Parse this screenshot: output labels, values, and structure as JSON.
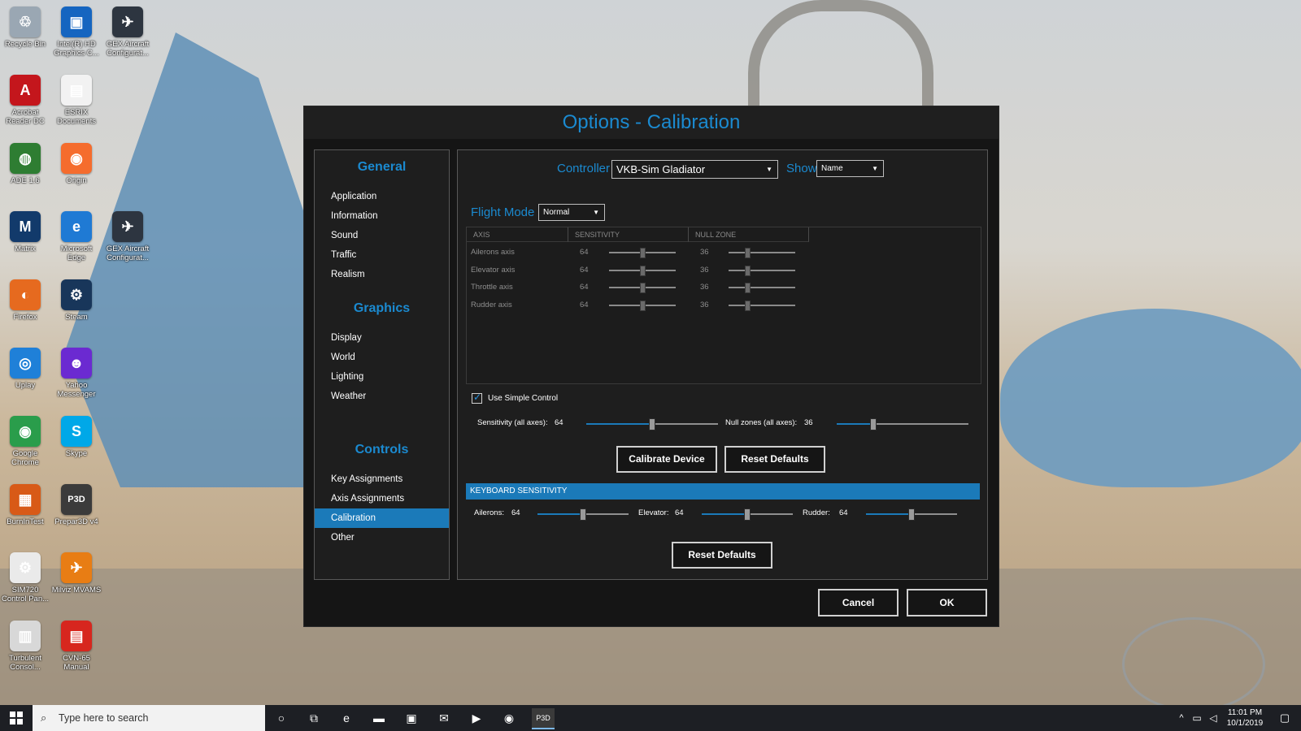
{
  "desktop": {
    "icons": [
      {
        "label": "Recycle Bin",
        "icon": "recycle-bin-icon",
        "color": "#9aa7b3",
        "glyph": "♲"
      },
      {
        "label": "Intel(R) HD Graphics C...",
        "icon": "intel-graphics-icon",
        "color": "#1565c0",
        "glyph": "▣"
      },
      {
        "label": "GEX Aircraft Configurat...",
        "icon": "gex-aircraft-icon",
        "color": "#2d3540",
        "glyph": "✈"
      },
      {
        "label": "Acrobat Reader DC",
        "icon": "acrobat-icon",
        "color": "#c4161c",
        "glyph": "A"
      },
      {
        "label": "ESRIX Documents",
        "icon": "document-icon",
        "color": "#f2f2f2",
        "glyph": "▤"
      },
      {
        "label": "ADE 1.6",
        "icon": "ade-globe-icon",
        "color": "#2e7d32",
        "glyph": "◍"
      },
      {
        "label": "Origin",
        "icon": "origin-icon",
        "color": "#f56c2d",
        "glyph": "◉"
      },
      {
        "label": "Matrix",
        "icon": "matrix-icon",
        "color": "#123a6b",
        "glyph": "M"
      },
      {
        "label": "Microsoft Edge",
        "icon": "edge-icon",
        "color": "#1f7ad4",
        "glyph": "e"
      },
      {
        "label": "GEX Aircraft Configurat...",
        "icon": "gex-aircraft-icon",
        "color": "#2d3540",
        "glyph": "✈"
      },
      {
        "label": "Firefox",
        "icon": "firefox-icon",
        "color": "#e66a1f",
        "glyph": "◐"
      },
      {
        "label": "Steam",
        "icon": "steam-icon",
        "color": "#18365a",
        "glyph": "⚙"
      },
      {
        "label": "Uplay",
        "icon": "uplay-icon",
        "color": "#1f80d8",
        "glyph": "◎"
      },
      {
        "label": "Yahoo Messenger",
        "icon": "yahoo-messenger-icon",
        "color": "#6b2ad1",
        "glyph": "☻"
      },
      {
        "label": "Google Chrome",
        "icon": "chrome-icon",
        "color": "#2a9d4b",
        "glyph": "◉"
      },
      {
        "label": "Skype",
        "icon": "skype-icon",
        "color": "#00a8e8",
        "glyph": "S"
      },
      {
        "label": "BurnInTest",
        "icon": "burnintest-icon",
        "color": "#d85a17",
        "glyph": "▦"
      },
      {
        "label": "Prepar3D v4",
        "icon": "prepar3d-icon",
        "color": "#3b3b3b",
        "glyph": "P3D"
      },
      {
        "label": "SIM720 Control Pan...",
        "icon": "sim720-icon",
        "color": "#eaeaea",
        "glyph": "⚙"
      },
      {
        "label": "Milviz MVAMS",
        "icon": "milviz-icon",
        "color": "#e87d14",
        "glyph": "✈"
      },
      {
        "label": "Turbulent Consol...",
        "icon": "turbulent-icon",
        "color": "#d8d8d8",
        "glyph": "▥"
      },
      {
        "label": "CVN-65 Manual",
        "icon": "cvn65-manual-icon",
        "color": "#d7261e",
        "glyph": "▤"
      }
    ]
  },
  "dialog": {
    "title": "Options - Calibration",
    "sidebar": {
      "sections": [
        {
          "heading": "General",
          "items": [
            "Application",
            "Information",
            "Sound",
            "Traffic",
            "Realism"
          ]
        },
        {
          "heading": "Graphics",
          "items": [
            "Display",
            "World",
            "Lighting",
            "Weather"
          ]
        },
        {
          "heading": "Controls",
          "items": [
            "Key Assignments",
            "Axis Assignments",
            "Calibration",
            "Other"
          ]
        }
      ],
      "active_item": "Calibration"
    },
    "controller_label": "Controller",
    "controller_value": "VKB-Sim Gladiator",
    "show_label": "Show",
    "show_value": "Name",
    "flight_mode_label": "Flight Mode",
    "flight_mode_value": "Normal",
    "table": {
      "headers": [
        "AXIS",
        "SENSITIVITY",
        "NULL ZONE"
      ],
      "rows": [
        {
          "axis": "Ailerons axis",
          "sensitivity": 64,
          "null_zone": 36
        },
        {
          "axis": "Elevator axis",
          "sensitivity": 64,
          "null_zone": 36
        },
        {
          "axis": "Throttle axis",
          "sensitivity": 64,
          "null_zone": 36
        },
        {
          "axis": "Rudder axis",
          "sensitivity": 64,
          "null_zone": 36
        }
      ],
      "slider_max": 128
    },
    "simple_control": {
      "label": "Use Simple Control",
      "checked": true
    },
    "sensitivity_all": {
      "label": "Sensitivity (all axes):",
      "value": "64",
      "fraction": 0.5
    },
    "null_zones_all": {
      "label": "Null zones (all axes):",
      "value": "36",
      "fraction": 0.28
    },
    "calibrate_label": "Calibrate Device",
    "reset_defaults_label": "Reset Defaults",
    "keyboard_header": "KEYBOARD SENSITIVITY",
    "keyboard": [
      {
        "label": "Ailerons:",
        "value": "64",
        "fraction": 0.5
      },
      {
        "label": "Elevator:",
        "value": "64",
        "fraction": 0.5
      },
      {
        "label": "Rudder:",
        "value": "64",
        "fraction": 0.5
      }
    ],
    "keyboard_reset_label": "Reset Defaults",
    "cancel_label": "Cancel",
    "ok_label": "OK"
  },
  "taskbar": {
    "search_placeholder": "Type here to search",
    "time": "11:01 PM",
    "date": "10/1/2019",
    "apps": [
      {
        "icon": "cortana-icon",
        "glyph": "○"
      },
      {
        "icon": "task-view-icon",
        "glyph": "⧉"
      },
      {
        "icon": "edge-icon",
        "glyph": "e"
      },
      {
        "icon": "file-explorer-icon",
        "glyph": "▬"
      },
      {
        "icon": "store-icon",
        "glyph": "▣"
      },
      {
        "icon": "mail-icon",
        "glyph": "✉"
      },
      {
        "icon": "media-player-icon",
        "glyph": "▶"
      },
      {
        "icon": "chrome-icon",
        "glyph": "◉"
      },
      {
        "icon": "prepar3d-icon",
        "glyph": "P3D"
      }
    ]
  },
  "colors": {
    "accent": "#1b8ad0",
    "active_item": "#1b7ab9",
    "dialog_bg": "#151515"
  }
}
